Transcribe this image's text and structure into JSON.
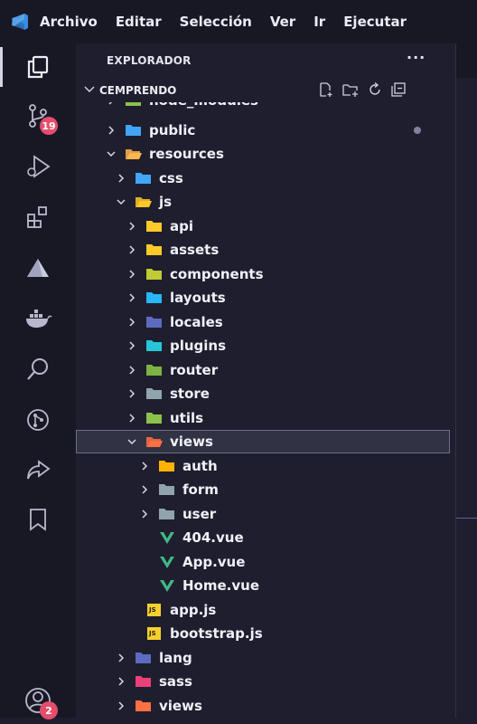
{
  "menu": [
    "Archivo",
    "Editar",
    "Selección",
    "Ver",
    "Ir",
    "Ejecutar"
  ],
  "activity_bar": [
    {
      "icon": "files-icon",
      "active": true,
      "badge": ""
    },
    {
      "icon": "source-control-icon",
      "badge": "19"
    },
    {
      "icon": "run-debug-icon",
      "badge": ""
    },
    {
      "icon": "extensions-icon",
      "badge": ""
    },
    {
      "icon": "deploy-triangle-icon",
      "badge": ""
    },
    {
      "icon": "docker-icon",
      "badge": ""
    },
    {
      "icon": "search-icon",
      "badge": ""
    },
    {
      "icon": "git-graph-icon",
      "badge": ""
    },
    {
      "icon": "live-share-icon",
      "badge": ""
    },
    {
      "icon": "bookmark-icon",
      "badge": ""
    },
    {
      "icon": "account-icon",
      "badge": "2"
    }
  ],
  "explorer": {
    "title": "EXPLORADOR",
    "more": "···",
    "section": "CEMPRENDO",
    "actions": [
      "new-file-icon",
      "new-folder-icon",
      "refresh-icon",
      "collapse-all-icon"
    ]
  },
  "tree": [
    {
      "name": "node_modules",
      "level": 1,
      "type": "folder",
      "expanded": false,
      "color": "#8bc34a"
    },
    {
      "name": "public",
      "level": 1,
      "type": "folder",
      "expanded": false,
      "color": "#42a5f5",
      "dot": true
    },
    {
      "name": "resources",
      "level": 1,
      "type": "folder",
      "expanded": true,
      "color": "#ffb74d"
    },
    {
      "name": "css",
      "level": 2,
      "type": "folder",
      "expanded": false,
      "color": "#42a5f5"
    },
    {
      "name": "js",
      "level": 2,
      "type": "folder",
      "expanded": true,
      "color": "#ffca28"
    },
    {
      "name": "api",
      "level": 3,
      "type": "folder",
      "expanded": false,
      "color": "#ffca28"
    },
    {
      "name": "assets",
      "level": 3,
      "type": "folder",
      "expanded": false,
      "color": "#ffca28"
    },
    {
      "name": "components",
      "level": 3,
      "type": "folder",
      "expanded": false,
      "color": "#c0ca33"
    },
    {
      "name": "layouts",
      "level": 3,
      "type": "folder",
      "expanded": false,
      "color": "#29b6f6"
    },
    {
      "name": "locales",
      "level": 3,
      "type": "folder",
      "expanded": false,
      "color": "#5c6bc0"
    },
    {
      "name": "plugins",
      "level": 3,
      "type": "folder",
      "expanded": false,
      "color": "#26c6da"
    },
    {
      "name": "router",
      "level": 3,
      "type": "folder",
      "expanded": false,
      "color": "#7cb342"
    },
    {
      "name": "store",
      "level": 3,
      "type": "folder",
      "expanded": false,
      "color": "#90a4ae"
    },
    {
      "name": "utils",
      "level": 3,
      "type": "folder",
      "expanded": false,
      "color": "#8bc34a"
    },
    {
      "name": "views",
      "level": 3,
      "type": "folder",
      "expanded": true,
      "color": "#ff7043",
      "selected": true
    },
    {
      "name": "auth",
      "level": 4,
      "type": "folder",
      "expanded": false,
      "color": "#ffb300"
    },
    {
      "name": "form",
      "level": 4,
      "type": "folder",
      "expanded": false,
      "color": "#90a4ae"
    },
    {
      "name": "user",
      "level": 4,
      "type": "folder",
      "expanded": false,
      "color": "#90a4ae"
    },
    {
      "name": "404.vue",
      "level": 4,
      "type": "vue"
    },
    {
      "name": "App.vue",
      "level": 4,
      "type": "vue"
    },
    {
      "name": "Home.vue",
      "level": 4,
      "type": "vue"
    },
    {
      "name": "app.js",
      "level": 3,
      "type": "js"
    },
    {
      "name": "bootstrap.js",
      "level": 3,
      "type": "js"
    },
    {
      "name": "lang",
      "level": 2,
      "type": "folder",
      "expanded": false,
      "color": "#5c6bc0"
    },
    {
      "name": "sass",
      "level": 2,
      "type": "folder",
      "expanded": false,
      "color": "#ec407a"
    },
    {
      "name": "views",
      "level": 2,
      "type": "folder",
      "expanded": false,
      "color": "#ff7043"
    }
  ],
  "file_icon_label": {
    "js": "JS"
  },
  "colors": {
    "vue": "#41b883",
    "js": "#f7d02c",
    "badge": "#e44d6c",
    "vscode": "#3a8dde"
  }
}
